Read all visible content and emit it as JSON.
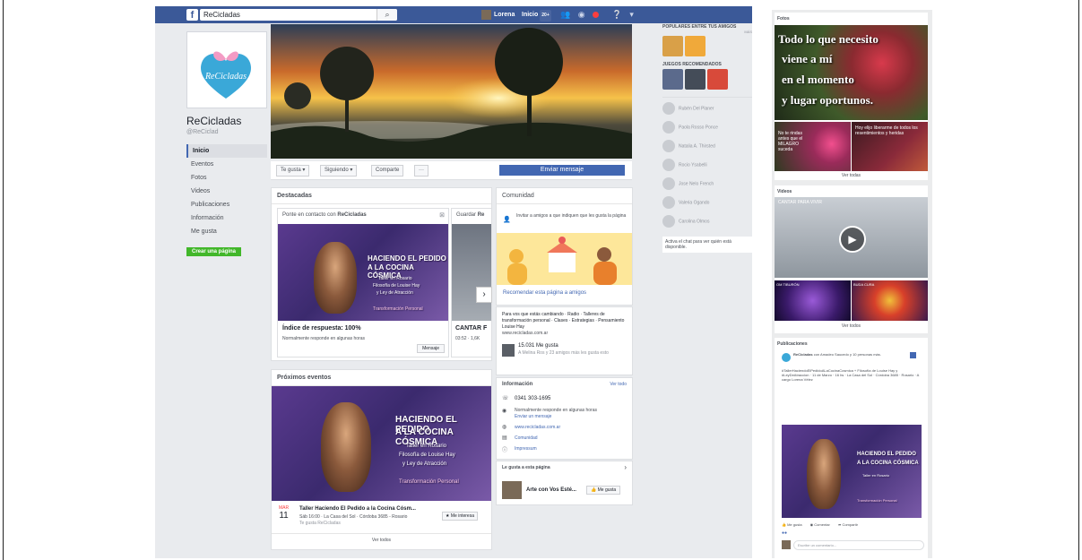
{
  "topbar": {
    "search_value": "ReCicladas",
    "user_name": "Lorena",
    "home_label": "Inicio",
    "home_badge": "20+",
    "brand_color": "#3b5998"
  },
  "page": {
    "name": "ReCicladas",
    "handle": "@ReCiclad",
    "logo_text": "ReCicladas"
  },
  "nav": {
    "items": [
      "Inicio",
      "Eventos",
      "Fotos",
      "Videos",
      "Publicaciones",
      "Información",
      "Me gusta"
    ],
    "create_page": "Crear una página"
  },
  "actions": {
    "like": "Te gusta ▾",
    "following": "Siguiendo ▾",
    "share": "Comparte",
    "more": "···",
    "send_message": "Enviar mensaje"
  },
  "highlights": {
    "title": "Destacadas",
    "contact_prefix": "Ponte en contacto con",
    "contact_name": "ReCicladas",
    "save_label": "Guardar",
    "save_name": "Re",
    "response_title": "Índice de respuesta: 100%",
    "response_sub": "Normalmente responde en algunas horas",
    "message_btn": "Mensaje",
    "next_title": "CANTAR F",
    "next_sub": "03:52 · 1,6K",
    "promo_lines": [
      "HACIENDO EL PEDIDO",
      "A LA COCINA CÓSMICA",
      "Taller en Rosario",
      "Filosofía de Louise Hay",
      "y Ley de Atracción",
      "Transformación Personal"
    ]
  },
  "community": {
    "title": "Comunidad",
    "invite": "Invitar a amigos a que indiquen que les gusta la página",
    "recommend": "Recomendar esta página a amigos",
    "about": "Para vos que estás cambiando · Radio · Talleres de transformación personal · Clases · Estrategias · Pensamiento Louise Hay",
    "about_url": "www.recicladas.com.ar",
    "likes": "15.031 Me gusta",
    "likes_sub": "A Melina Ros y 23 amigos más les gusta esto"
  },
  "info": {
    "title": "Información",
    "see_all": "Ver todo",
    "phone": "0341 303-1695",
    "response": "Normalmente responde en algunas horas",
    "send_msg": "Enviar un mensaje",
    "website": "www.recicladas.com.ar",
    "category": "Comunidad",
    "imprint": "Impressum"
  },
  "liked_by": {
    "title": "Le gusta a esta página",
    "item": "Arte con Vos Esté...",
    "btn": "Me gusta"
  },
  "events": {
    "title": "Próximos eventos",
    "month": "MAR",
    "day": "11",
    "event_title": "Taller  Haciendo El Pedido a la Cocina Cósm...",
    "event_sub": "Sáb 16:00 · La Casa del Sol · Córdoba 3685 - Rosario",
    "event_sub2": "Te gusta ReCicladas",
    "interest_btn": "★ Me interesa",
    "see_all": "Ver todos"
  },
  "right_col": {
    "popular": "POPULARES ENTRE TUS AMIGOS",
    "more": "MÁS",
    "games": "JUEGOS RECOMENDADOS",
    "friends": [
      "Rubén Del Planer",
      "Paola Rosso Ponce",
      "Natalia A. Thirsted",
      "Rocio Ysabelli",
      "Jose Nelo French",
      "Valeria Ogando",
      "Carolina Olmos"
    ],
    "chat": "Activa el chat para ver quién está disponible."
  },
  "photos": {
    "title": "Fotos",
    "quote_lines": [
      "Todo lo que necesito",
      "viene a mí",
      "en el momento",
      "y lugar oportunos."
    ],
    "milagro": "No te rindas antes que el MILAGRO suceda",
    "heal": "Hoy elijo liberarme de todos los resentimientos y heridas",
    "see_all": "Ver todas"
  },
  "videos": {
    "title": "Videos",
    "main_label": "CANTAR PARA VIVIR",
    "thumb1": "OM TIBURÓN",
    "thumb2": "BUDA CURA",
    "see_all": "Ver todos"
  },
  "publications": {
    "title": "Publicaciones",
    "author": "ReCicladas",
    "with": "con Amadeo Saucedo y 10 personas más.",
    "post_text": "#TallerHaciendoElPedidoALaCocinaCosmica + Filosofía de Louise Hay y #LeyDeAtraccion · 11 de Marzo · 16 hs · La Casa del Sol · Córdoba 3685 · Rosario · A cargo Lorena Vélez",
    "promo_lines": [
      "HACIENDO EL PEDIDO",
      "A LA COCINA CÓSMICA",
      "Taller en Rosario",
      "Transformación Personal"
    ],
    "like": "Me gusta",
    "comment": "Comentar",
    "share": "Compartir",
    "comment_placeholder": "Escribe un comentario..."
  }
}
